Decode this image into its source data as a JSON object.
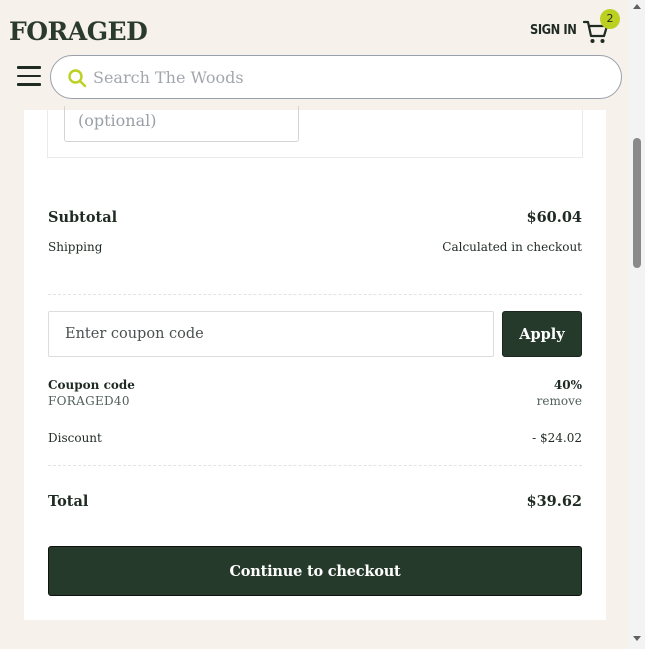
{
  "header": {
    "logo": "FORAGED",
    "signin_label": "SIGN IN",
    "cart_count": "2",
    "search_placeholder": "Search The Woods"
  },
  "note_field": {
    "placeholder": "(optional)"
  },
  "summary": {
    "subtotal_label": "Subtotal",
    "subtotal_value": "$60.04",
    "shipping_label": "Shipping",
    "shipping_value": "Calculated in checkout"
  },
  "coupon": {
    "placeholder": "Enter coupon code",
    "apply_label": "Apply",
    "code_label": "Coupon code",
    "code_value": "FORAGED40",
    "percent": "40%",
    "remove_label": "remove",
    "discount_label": "Discount",
    "discount_value": "- $24.02"
  },
  "total": {
    "label": "Total",
    "value": "$39.62"
  },
  "checkout_label": "Continue to checkout",
  "colors": {
    "brand_dark": "#263a2c",
    "accent": "#bcd022",
    "background": "#f7f1ec"
  }
}
